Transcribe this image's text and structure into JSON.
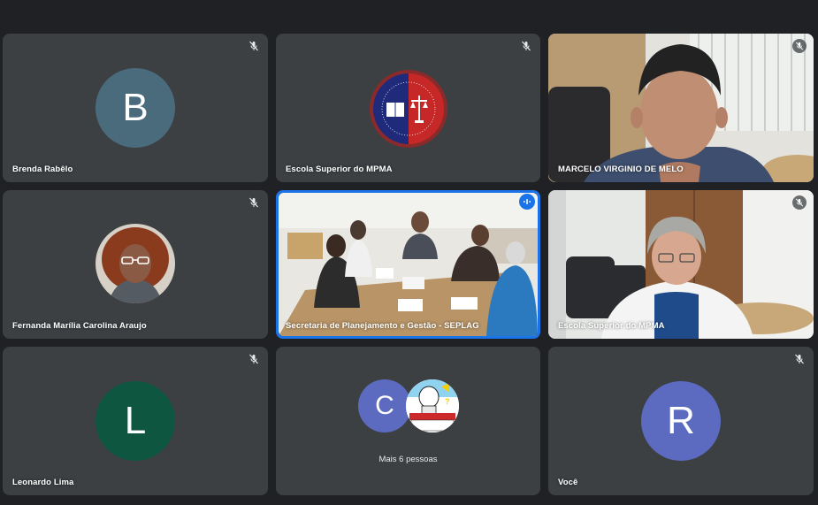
{
  "participants": [
    {
      "name": "Brenda Rabêlo",
      "initial": "B",
      "avatar_color": "#4a6b7c",
      "muted": true
    },
    {
      "name": "Escola Superior do MPMA",
      "logo_text": "PENSAR PARA TRANSFORMAR",
      "muted": true
    },
    {
      "name": "MARCELO VIRGINIO DE MELO",
      "muted": true,
      "video": true
    },
    {
      "name": "Fernanda Marília Carolina Araujo",
      "muted": true
    },
    {
      "name": "Secretaria de Planejamento e Gestão - SEPLAG",
      "speaking": true,
      "video": true
    },
    {
      "name": "Escola Superior do MPMA",
      "muted": true,
      "video": true
    },
    {
      "name": "Leonardo Lima",
      "initial": "L",
      "avatar_color": "#0e5640",
      "muted": true
    },
    {
      "more": "Mais 6 pessoas",
      "initial": "C",
      "avatar_color": "#5c6bc0",
      "cartoon_text": "O QUE VOCÊ TEM A VER COM A CORRUPÇÃO?"
    },
    {
      "name": "Você",
      "initial": "R",
      "avatar_color": "#5c6bc0",
      "muted": true
    }
  ],
  "colors": {
    "background": "#202124",
    "tile": "#3c4043",
    "accent": "#1a73e8"
  }
}
